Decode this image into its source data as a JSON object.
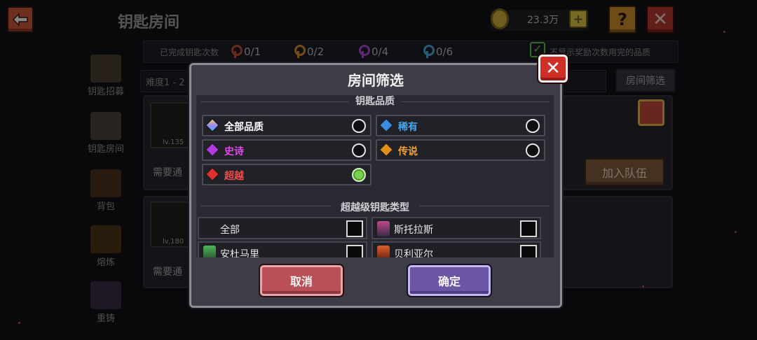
{
  "header": {
    "title": "钥匙房间",
    "coins": "23.3万"
  },
  "stats": {
    "label": "已完成钥匙次数",
    "items": [
      {
        "value": "0/1",
        "color": "#c24a3a"
      },
      {
        "value": "0/2",
        "color": "#d08a2c"
      },
      {
        "value": "0/4",
        "color": "#a64ad0"
      },
      {
        "value": "0/6",
        "color": "#4aa6d0"
      }
    ],
    "hide_label": "不显示奖励次数用完的品质"
  },
  "difficulty_label": "难度1 - 2",
  "filter_button": "房间筛选",
  "sidebar": [
    {
      "label": "钥匙招募",
      "icon": "recruit-icon"
    },
    {
      "label": "钥匙房间",
      "icon": "key-room-icon"
    },
    {
      "label": "背包",
      "icon": "backpack-icon"
    },
    {
      "label": "熔炼",
      "icon": "smelt-icon"
    },
    {
      "label": "重铸",
      "icon": "recast-icon"
    }
  ],
  "cards": [
    {
      "level": "lv.135",
      "need": "需要通"
    },
    {
      "level": "lv.180",
      "need": "需要通"
    }
  ],
  "join_button": "加入队伍",
  "modal": {
    "title": "房间筛选",
    "quality_section": "钥匙品质",
    "qualities": [
      {
        "label": "全部品质",
        "color": "#ffffff",
        "gem": "#9a8cf0",
        "selected": false
      },
      {
        "label": "稀有",
        "color": "#4aa8f0",
        "gem": "#3a8ce0",
        "selected": false
      },
      {
        "label": "史诗",
        "color": "#e04ae8",
        "gem": "#b03ae0",
        "selected": false
      },
      {
        "label": "传说",
        "color": "#f0a030",
        "gem": "#e0901a",
        "selected": false
      },
      {
        "label": "超越",
        "color": "#f04a4a",
        "gem": "#e03030",
        "selected": true
      }
    ],
    "type_section": "超越级钥匙类型",
    "types": [
      {
        "label": "全部",
        "icon": ""
      },
      {
        "label": "斯托拉斯",
        "icon": "stolas-icon"
      },
      {
        "label": "安杜马里",
        "icon": "andumari-icon"
      },
      {
        "label": "贝利亚尔",
        "icon": "belial-icon"
      }
    ],
    "cancel": "取消",
    "confirm": "确定"
  }
}
